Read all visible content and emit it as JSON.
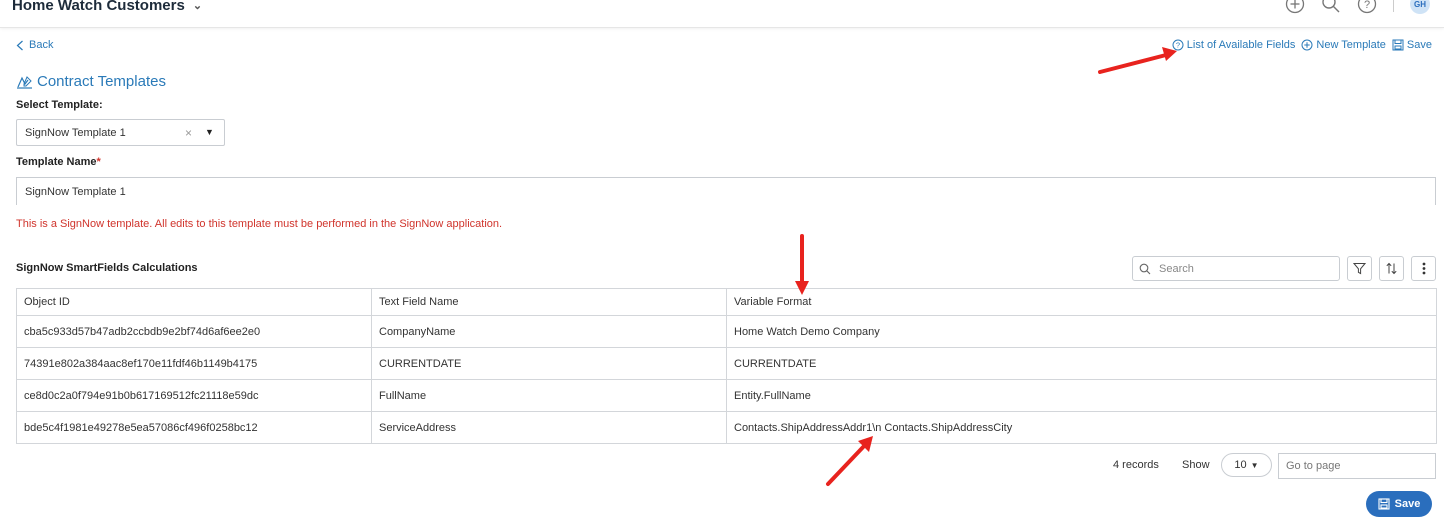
{
  "header": {
    "app_title": "Home Watch Customers",
    "avatar_initials": "GH"
  },
  "nav": {
    "back_label": "Back"
  },
  "actions": {
    "list_fields_label": "List of Available Fields",
    "new_template_label": "New Template",
    "save_label": "Save"
  },
  "page": {
    "title": "Contract Templates"
  },
  "form": {
    "select_template_label": "Select Template:",
    "select_template_value": "SignNow Template 1",
    "template_name_label": "Template Name",
    "required_mark": "*",
    "template_name_value": "SignNow Template 1",
    "warning": "This is a SignNow template. All edits to this template must be performed in the SignNow application."
  },
  "grid": {
    "title": "SignNow SmartFields Calculations",
    "search_placeholder": "Search",
    "columns": [
      "Object ID",
      "Text Field Name",
      "Variable Format"
    ],
    "rows": [
      [
        "cba5c933d57b47adb2ccbdb9e2bf74d6af6ee2e0",
        "CompanyName",
        "Home Watch Demo Company"
      ],
      [
        "74391e802a384aac8ef170e11fdf46b1149b4175",
        "CURRENTDATE",
        "CURRENTDATE"
      ],
      [
        "ce8d0c2a0f794e91b0b617169512fc21118e59dc",
        "FullName",
        "Entity.FullName"
      ],
      [
        "bde5c4f1981e49278e5ea57086cf496f0258bc12",
        "ServiceAddress",
        "Contacts.ShipAddressAddr1\\n Contacts.ShipAddressCity"
      ]
    ]
  },
  "pager": {
    "records_label": "4 records",
    "show_label": "Show",
    "page_size": "10",
    "goto_placeholder": "Go to page"
  },
  "footer": {
    "save_label": "Save"
  },
  "colors": {
    "accent": "#2a6ebd",
    "link": "#2a7ab8",
    "error": "#d0342c",
    "annotation": "#e8231e"
  }
}
